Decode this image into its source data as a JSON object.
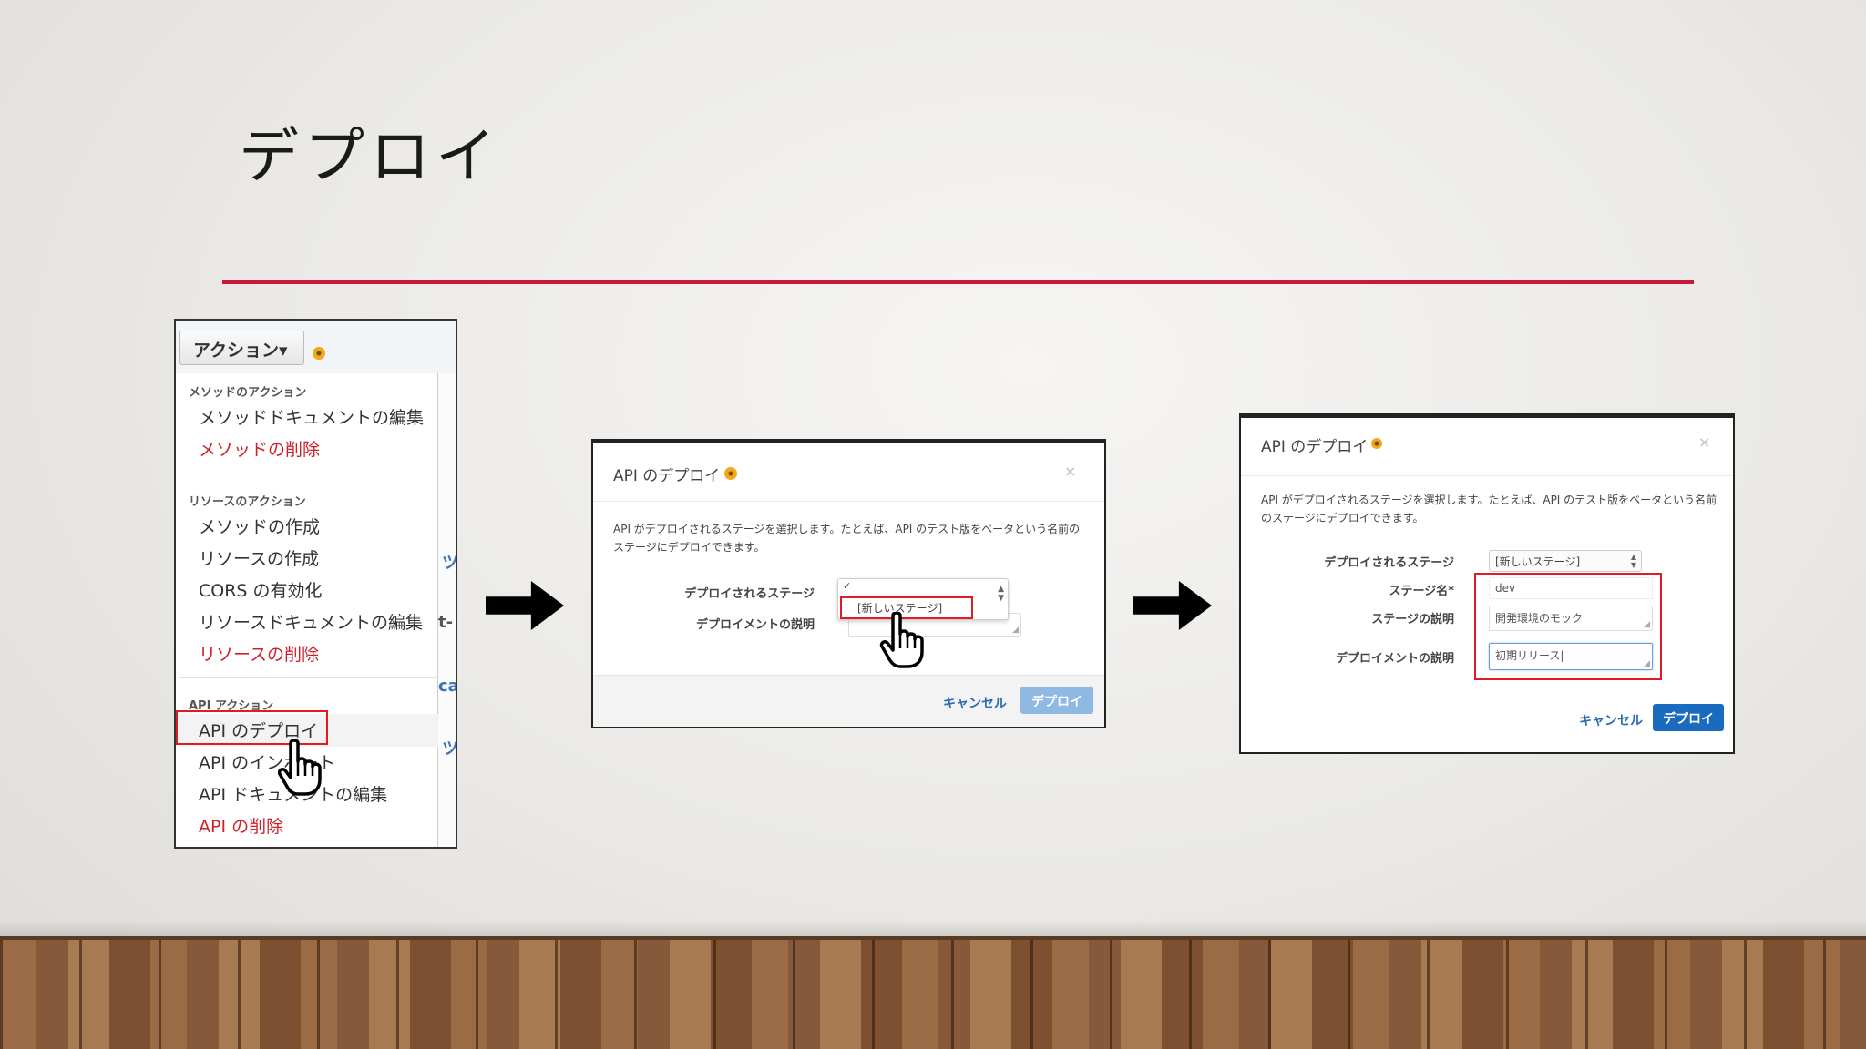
{
  "slide": {
    "title": "デプロイ"
  },
  "colors": {
    "accent_rule": "#c8183c",
    "highlight_box": "#e01b24",
    "primary_button": "#1a6ac0",
    "primary_button_disabled": "#8fb8e2"
  },
  "panel1": {
    "actions_button": "アクション▾",
    "method_section": "メソッドのアクション",
    "method_items": [
      {
        "label": "メソッドドキュメントの編集"
      },
      {
        "label": "メソッドの削除"
      }
    ],
    "resource_section": "リソースのアクション",
    "resource_items": [
      {
        "label": "メソッドの作成"
      },
      {
        "label": "リソースの作成"
      },
      {
        "label": "CORS の有効化"
      },
      {
        "label": "リソースドキュメントの編集"
      },
      {
        "label": "リソースの削除"
      }
    ],
    "api_section": "API アクション",
    "api_items": [
      {
        "label": "API のデプロイ"
      },
      {
        "label": "API のインポート"
      },
      {
        "label": "API ドキュメントの編集"
      },
      {
        "label": "API の削除"
      }
    ],
    "edge_fragments": [
      "ツ",
      "t-",
      "ca",
      "ツ"
    ]
  },
  "dialog_a": {
    "title": "API のデプロイ",
    "close": "×",
    "description": "API がデプロイされるステージを選択します。たとえば、API のテスト版をベータという名前のステージにデプロイできます。",
    "stage_label": "デプロイされるステージ",
    "dropdown_check": "✓",
    "dropdown_option": "[新しいステージ]",
    "deployment_desc_label": "デプロイメントの説明",
    "cancel": "キャンセル",
    "deploy": "デプロイ"
  },
  "dialog_b": {
    "title": "API のデプロイ",
    "close": "×",
    "description": "API がデプロイされるステージを選択します。たとえば、API のテスト版をベータという名前のステージにデプロイできます。",
    "stage_label": "デプロイされるステージ",
    "stage_value": "[新しいステージ]",
    "stage_name_label": "ステージ名*",
    "stage_name_value": "dev",
    "stage_desc_label": "ステージの説明",
    "stage_desc_value": "開発環境のモック",
    "deployment_desc_label": "デプロイメントの説明",
    "deployment_desc_value": "初期リリース",
    "cancel": "キャンセル",
    "deploy": "デプロイ"
  }
}
